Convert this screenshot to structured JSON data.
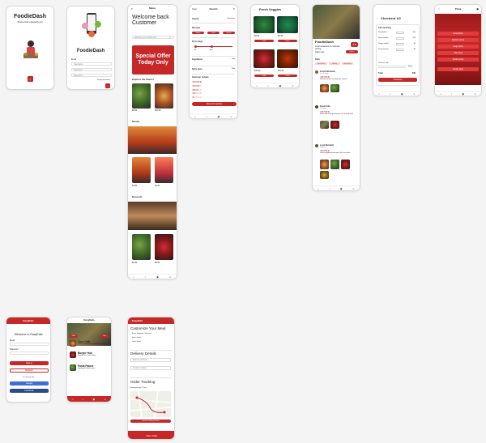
{
  "colors": {
    "accent": "#c62828",
    "accent_light": "#e23b3b",
    "bg": "#f4f4f4"
  },
  "splash": {
    "title": "FoodieDash",
    "tagline": "Browse local restaurants and",
    "logo_icon": "fork-knife-icon"
  },
  "login": {
    "title": "FoodieDash",
    "email_label": "Email",
    "email_placeholder": "Username",
    "password_placeholder": "Password",
    "confirm_placeholder": "Password",
    "forgot": "Forgot password?",
    "submit_icon": "arrow-right-icon"
  },
  "home": {
    "header": "Menu",
    "greeting": "Welcome back Customer",
    "search_placeholder": "What are you craving for?",
    "offer": "Special Offer Today Only",
    "sections": {
      "explore": "Explore the flavors",
      "drinks": "Drinks",
      "desserts": "Desserts"
    },
    "explore_items": [
      {
        "name": "Salad",
        "price": "$9.99"
      },
      {
        "name": "Bowl",
        "price": "$12.99"
      }
    ],
    "drink_items": [
      {
        "name": "Cola",
        "price": "$3.99"
      },
      {
        "name": "Soda",
        "price": "$4.49"
      }
    ],
    "dessert_items": [
      {
        "name": "Cake",
        "price": "$6.99"
      },
      {
        "name": "Tart",
        "price": "$5.99"
      }
    ]
  },
  "search": {
    "header": "Search",
    "clear": "Clear",
    "cuisine_label": "Cuisine",
    "cuisine_value": "Vegetarian",
    "diet_label": "Diet type",
    "diet_chips": [
      "Vegan",
      "Halal",
      "Kosher"
    ],
    "price_label": "Price range",
    "price_min": "$0",
    "price_max": "$40",
    "ingredients_label": "Ingredients",
    "ingredients_value": "Any",
    "spice_label": "Spice level",
    "spice_value": "Mild",
    "reviews_label": "Customer reviews",
    "show_button": "Show 16 options"
  },
  "veggies": {
    "header": "Fresh Veggies",
    "items": [
      {
        "name": "Green Salad",
        "price": "$8.99",
        "btn": "Order"
      },
      {
        "name": "Veggie Bowl",
        "price": "$9.49",
        "btn": "Order"
      },
      {
        "name": "Roasted Veg",
        "price": "$10.99",
        "btn": "Order"
      },
      {
        "name": "Veg Stew",
        "price": "$11.29",
        "btn": "Order"
      }
    ]
  },
  "restaurant": {
    "name": "FoodieDash",
    "desc": "Local restaurant of moderate pricing",
    "order_now": "Order now",
    "rating": "4.8",
    "login_btn": "Log in",
    "filter_label": "Filter",
    "filters": [
      "Latest first",
      "Rating",
      "Has photo"
    ],
    "reviews": [
      {
        "author": "Food Enthusiast",
        "role": "Local Guide",
        "text": "Delicious dishes and fantastic service!"
      },
      {
        "author": "Food Critic",
        "role": "Reviewer",
        "text": "Warm and inviting ambiance with friendly staff."
      },
      {
        "author": "Local Resident",
        "role": "Regular",
        "text": "Great neighbourhood spot, will come back."
      }
    ]
  },
  "checkout": {
    "header": "Checkout 1/2",
    "summary_title": "Cart summary",
    "items": [
      {
        "name": "Strawberries",
        "price": "$10"
      },
      {
        "name": "Spicy noodles",
        "price": "$12"
      },
      {
        "name": "Veggie delight",
        "price": "$8"
      },
      {
        "name": "Sweet dessert",
        "price": "$6"
      }
    ],
    "discount_label": "Discount code",
    "apply": "Apply",
    "total_label": "Total",
    "total_value": "$36",
    "button": "Checkout"
  },
  "pizza": {
    "header": "Pizza",
    "menu": [
      "Small pizza",
      "Medium pizza",
      "Large pizza",
      "Thin crust",
      "Stuffed crust",
      "Family deal"
    ]
  },
  "easyeats": {
    "header": "EasyEats",
    "welcome": "Welcome to EasyEats",
    "email_label": "Email",
    "password_label": "Password",
    "sign_in": "Sign in",
    "register": "Register",
    "or": "Or continue with",
    "google": "Google",
    "facebook": "Facebook"
  },
  "list": {
    "header": "EasyEats",
    "filter": "Filter",
    "sort": "Sort",
    "items": [
      {
        "name": "Cozy Cafe",
        "desc": "Coffee, sandwiches and delicious cakes"
      },
      {
        "name": "Burger Hub",
        "desc": "Burgers, fries and shakes"
      },
      {
        "name": "Pasta Palace",
        "desc": "Handmade Italian pasta"
      }
    ]
  },
  "meal": {
    "header": "EasyEats",
    "title": "Customize Your Meal",
    "option1": "Basic Spaghetti Carbonara",
    "option2": "Extra cheese",
    "option3": "Garlic bread",
    "delivery_title": "Delivery Details",
    "address_placeholder": "Delivery address",
    "phone_placeholder": "Contact number",
    "tracking_title": "Order Tracking",
    "tracking_status": "Estimated time: 25 min",
    "contact": "Contact Delivery Partner",
    "order_button": "Place Order"
  }
}
